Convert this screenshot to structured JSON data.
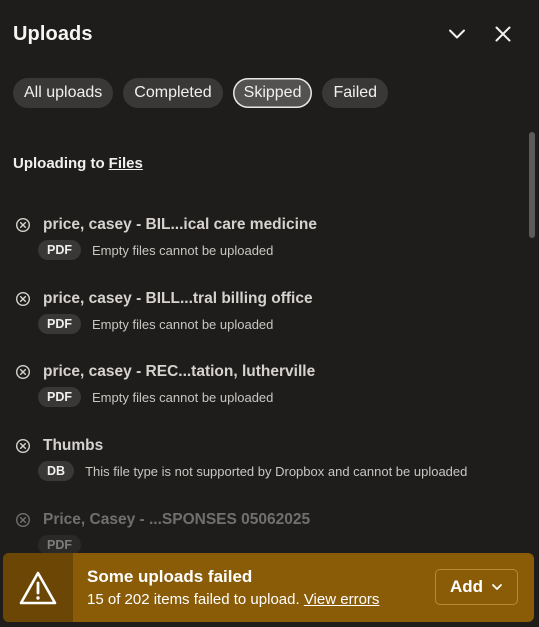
{
  "header": {
    "title": "Uploads"
  },
  "filters": [
    {
      "label": "All uploads",
      "active": false
    },
    {
      "label": "Completed",
      "active": false
    },
    {
      "label": "Skipped",
      "active": true
    },
    {
      "label": "Failed",
      "active": false
    }
  ],
  "destination": {
    "prefix": "Uploading to",
    "folder": "Files"
  },
  "items": [
    {
      "name": "price, casey - BIL...ical care medicine",
      "type": "PDF",
      "message": "Empty files cannot be uploaded"
    },
    {
      "name": "price, casey - BILL...tral billing office",
      "type": "PDF",
      "message": "Empty files cannot be uploaded"
    },
    {
      "name": "price, casey - REC...tation, lutherville",
      "type": "PDF",
      "message": "Empty files cannot be uploaded"
    },
    {
      "name": "Thumbs",
      "type": "DB",
      "message": "This file type is not supported by Dropbox and cannot be uploaded"
    },
    {
      "name": "Price, Casey - ...SPONSES 05062025",
      "type": "PDF",
      "message": ""
    }
  ],
  "toast": {
    "title": "Some uploads failed",
    "summary": "15 of 202 items failed to upload.",
    "link": "View errors",
    "add_label": "Add"
  },
  "colors": {
    "background": "#1e1d1c",
    "pill": "#3a3836",
    "toast": "#8a5c08",
    "toast_icon_bg": "#6b4605"
  }
}
